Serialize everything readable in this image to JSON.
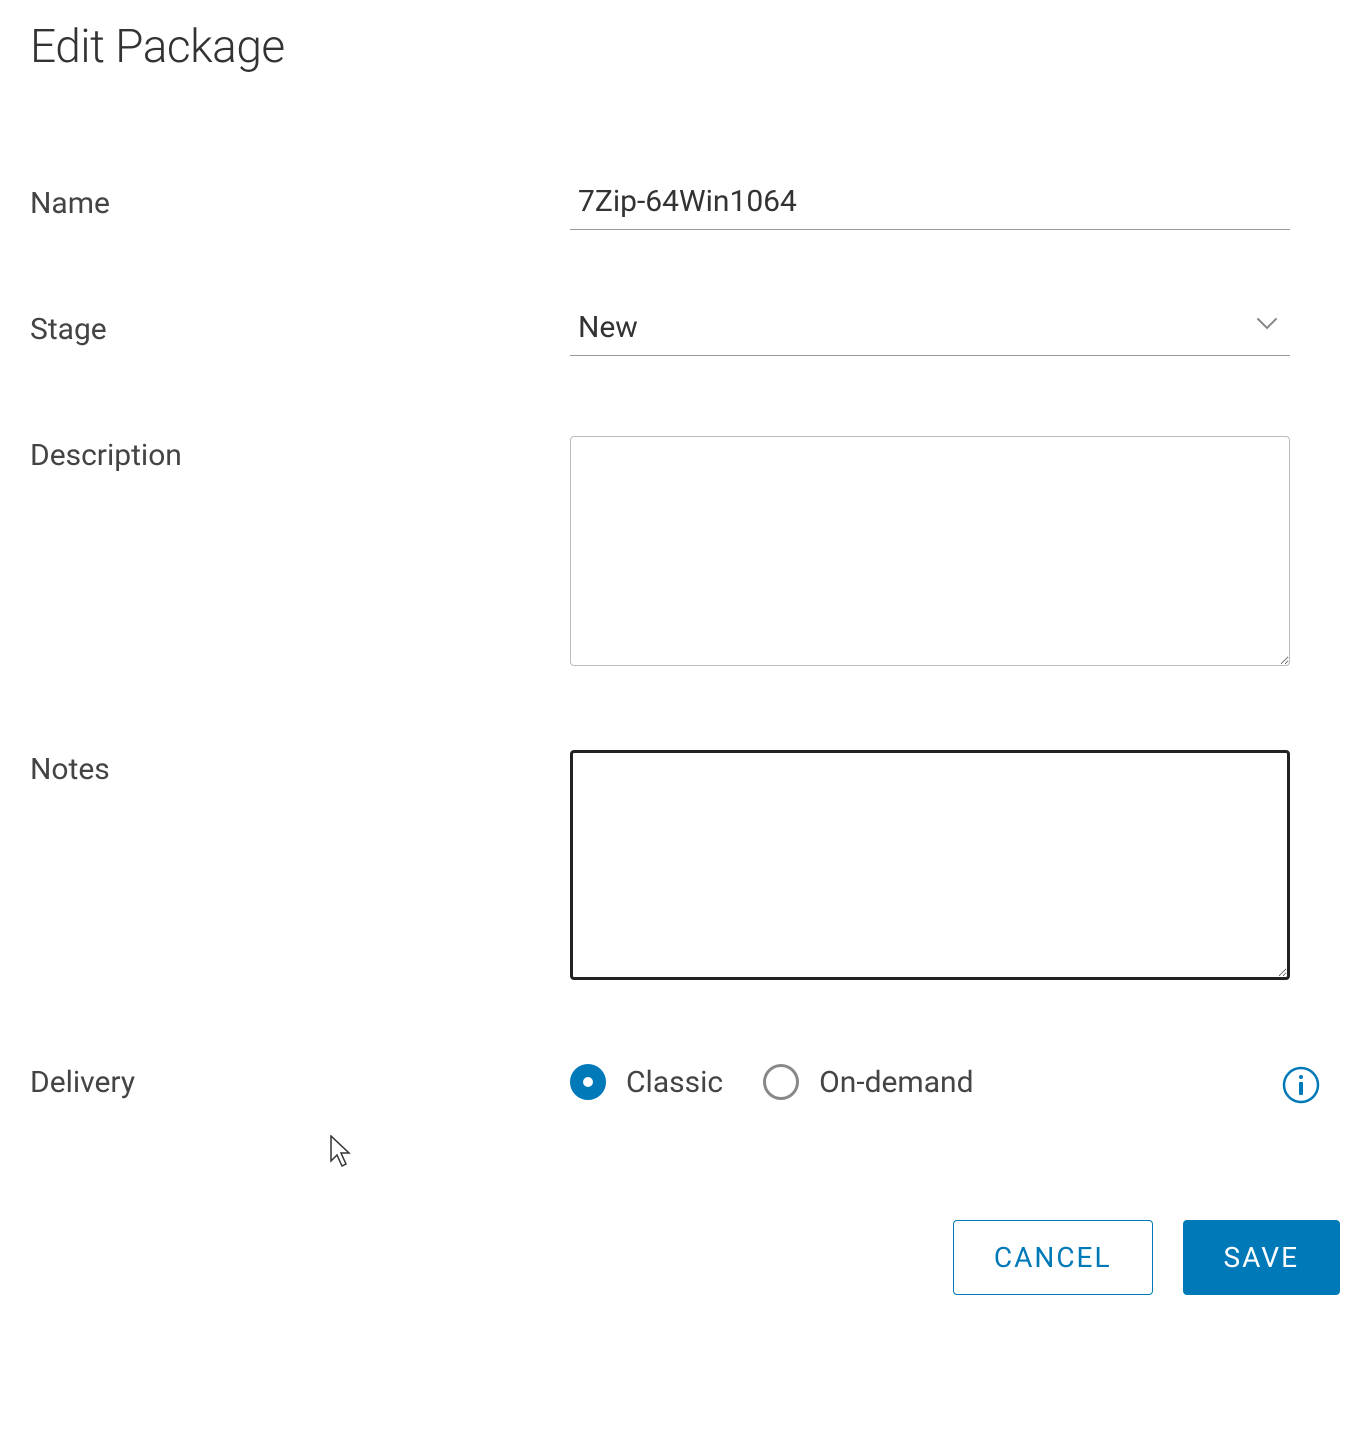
{
  "title": "Edit Package",
  "form": {
    "name": {
      "label": "Name",
      "value": "7Zip-64Win1064"
    },
    "stage": {
      "label": "Stage",
      "value": "New"
    },
    "description": {
      "label": "Description",
      "value": ""
    },
    "notes": {
      "label": "Notes",
      "value": ""
    },
    "delivery": {
      "label": "Delivery",
      "options": [
        {
          "label": "Classic",
          "selected": true
        },
        {
          "label": "On-demand",
          "selected": false
        }
      ]
    }
  },
  "buttons": {
    "cancel": "Cancel",
    "save": "Save"
  }
}
